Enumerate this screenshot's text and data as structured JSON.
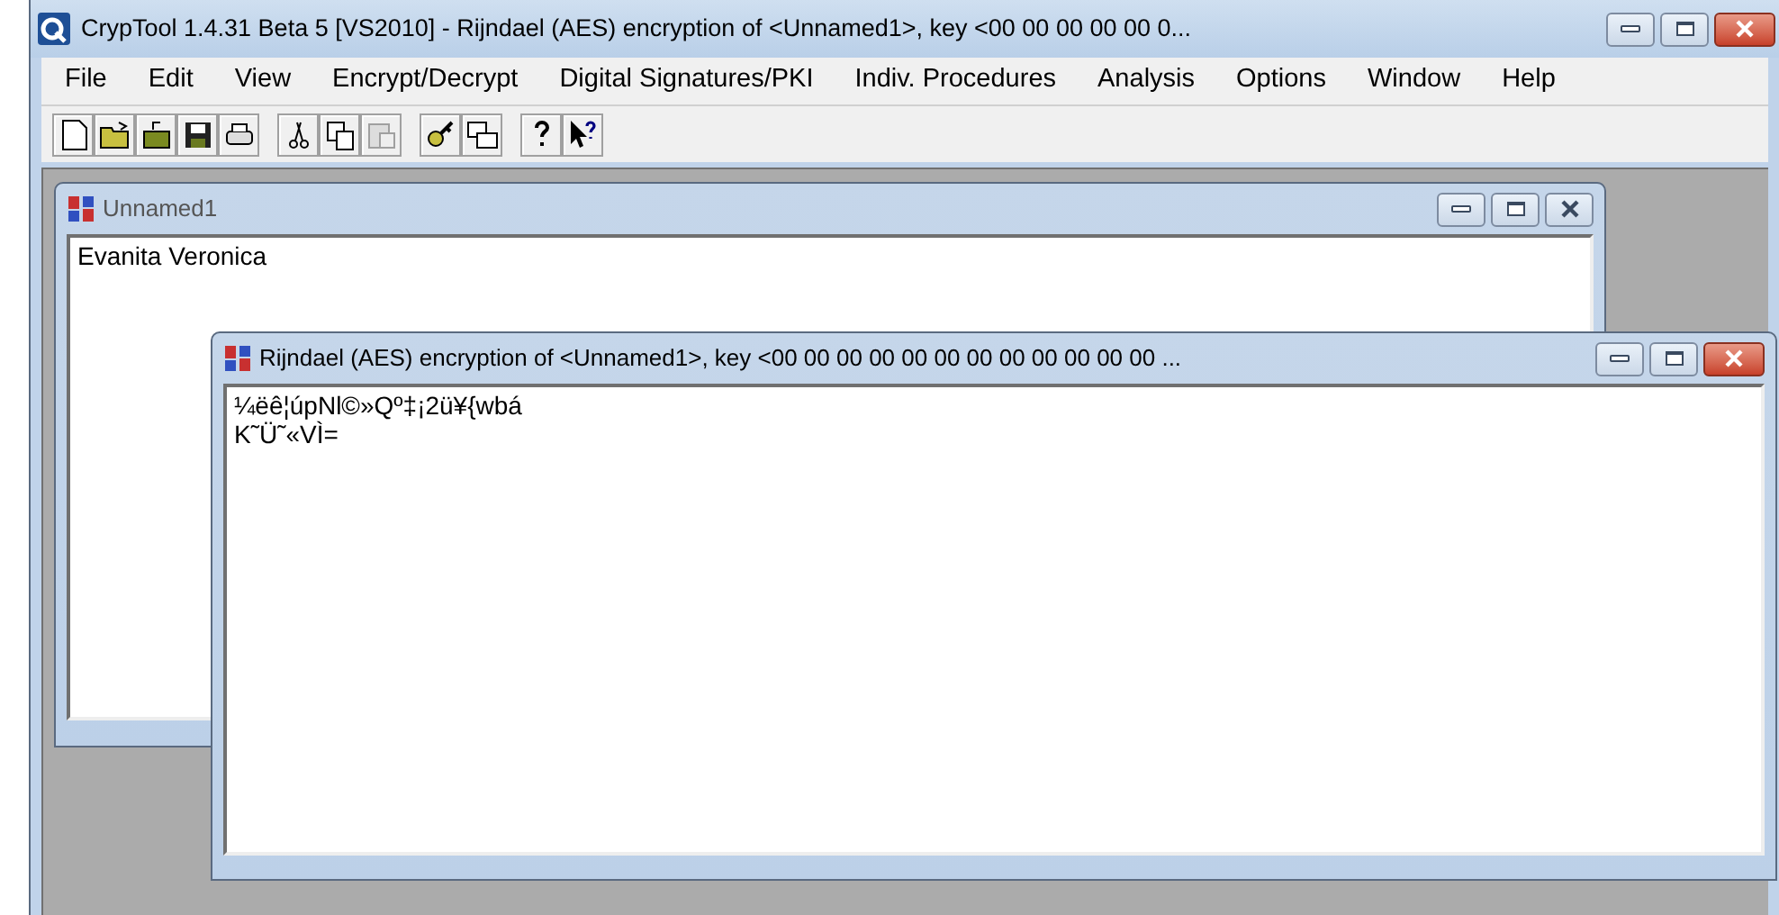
{
  "window": {
    "title": "CrypTool 1.4.31 Beta 5 [VS2010] - Rijndael (AES) encryption of <Unnamed1>, key <00 00 00 00 00 0..."
  },
  "menu": [
    "File",
    "Edit",
    "View",
    "Encrypt/Decrypt",
    "Digital Signatures/PKI",
    "Indiv. Procedures",
    "Analysis",
    "Options",
    "Window",
    "Help"
  ],
  "toolbar": [
    [
      {
        "kind": "new",
        "disabled": false
      },
      {
        "kind": "open",
        "disabled": false
      },
      {
        "kind": "open-other",
        "disabled": false
      },
      {
        "kind": "save",
        "disabled": false
      },
      {
        "kind": "print",
        "disabled": false
      }
    ],
    [
      {
        "kind": "cut",
        "disabled": false
      },
      {
        "kind": "copy",
        "disabled": false
      },
      {
        "kind": "paste",
        "disabled": true
      }
    ],
    [
      {
        "kind": "key",
        "disabled": false
      },
      {
        "kind": "windows",
        "disabled": false
      }
    ],
    [
      {
        "kind": "help",
        "disabled": false
      },
      {
        "kind": "context-help",
        "disabled": false
      }
    ]
  ],
  "documents": [
    {
      "title": "Unnamed1",
      "active": false,
      "lines": [
        "Evanita Veronica"
      ]
    },
    {
      "title": "Rijndael (AES) encryption of <Unnamed1>, key <00 00 00 00 00 00 00 00 00 00 00 00 ...",
      "active": true,
      "lines": [
        "¼ëê¦úpNl©»Qº‡¡2ü¥{wbá",
        "K˜Ü˜«VÌ="
      ]
    }
  ]
}
